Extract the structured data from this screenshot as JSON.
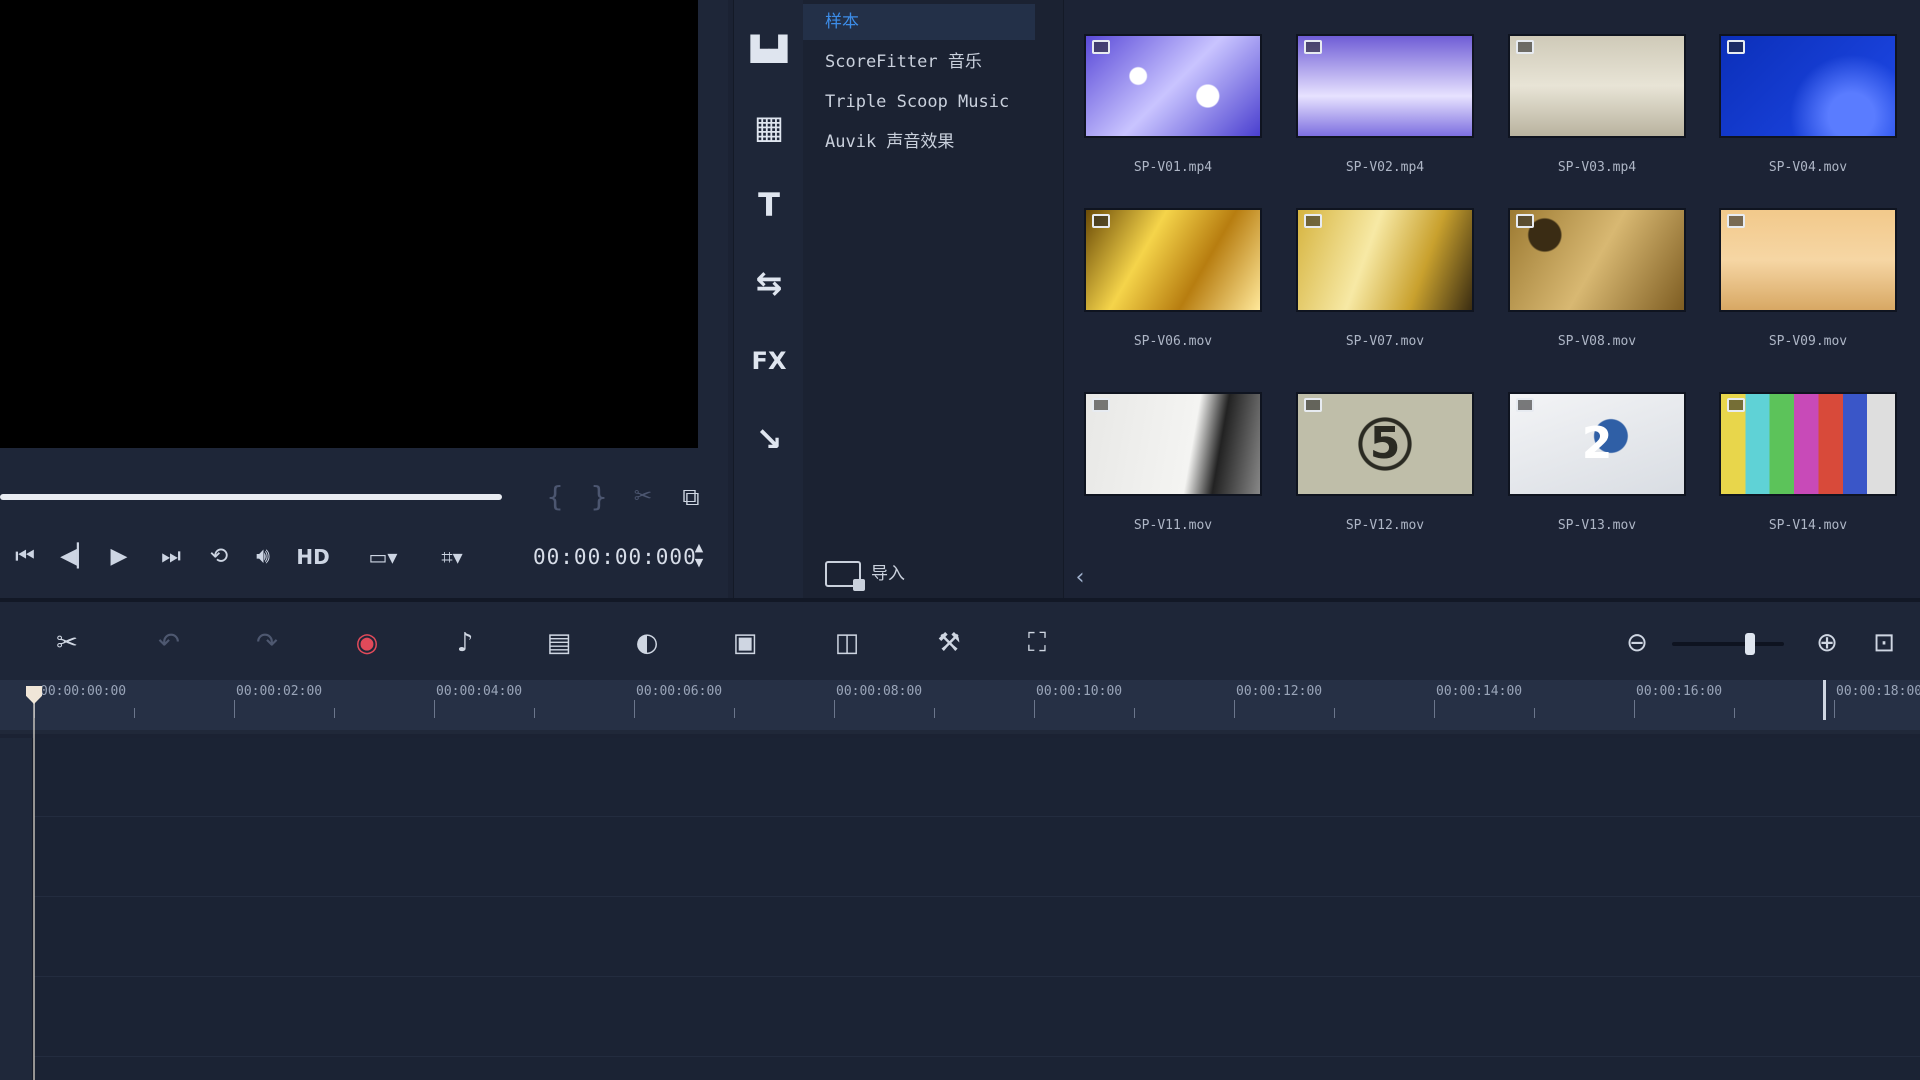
{
  "player": {
    "timecode": "00:00:00:000",
    "quality_label": "HD"
  },
  "categories": [
    {
      "label": "样本",
      "active": true
    },
    {
      "label": "ScoreFitter 音乐",
      "active": false
    },
    {
      "label": "Triple Scoop Music",
      "active": false
    },
    {
      "label": "Auvik 声音效果",
      "active": false
    }
  ],
  "import_label": "导入",
  "library_tools": [
    {
      "icon": "media-icon",
      "glyph": "▙▟"
    },
    {
      "icon": "instant-project-icon",
      "glyph": "▦"
    },
    {
      "icon": "title-icon",
      "glyph": "T"
    },
    {
      "icon": "transition-icon",
      "glyph": "⇆"
    },
    {
      "icon": "filter-fx-icon",
      "glyph": "FX"
    },
    {
      "icon": "path-icon",
      "glyph": "↘"
    }
  ],
  "thumbnails": [
    {
      "name": "SP-V01.mp4"
    },
    {
      "name": "SP-V02.mp4"
    },
    {
      "name": "SP-V03.mp4"
    },
    {
      "name": "SP-V04.mov"
    },
    {
      "name": "SP-V06.mov"
    },
    {
      "name": "SP-V07.mov"
    },
    {
      "name": "SP-V08.mov"
    },
    {
      "name": "SP-V09.mov"
    },
    {
      "name": "SP-V11.mov"
    },
    {
      "name": "SP-V12.mov"
    },
    {
      "name": "SP-V13.mov"
    },
    {
      "name": "SP-V14.mov"
    }
  ],
  "ruler_labels": [
    "00:00:00:00",
    "00:00:02:00",
    "00:00:04:00",
    "00:00:06:00",
    "00:00:08:00",
    "00:00:10:00",
    "00:00:12:00",
    "00:00:14:00",
    "00:00:16:00",
    "00:00:18:00"
  ],
  "colors": {
    "accent": "#3c8ce7",
    "panel": "#1e2638",
    "preview": "#000000"
  },
  "zoom_level_fraction": 0.72
}
